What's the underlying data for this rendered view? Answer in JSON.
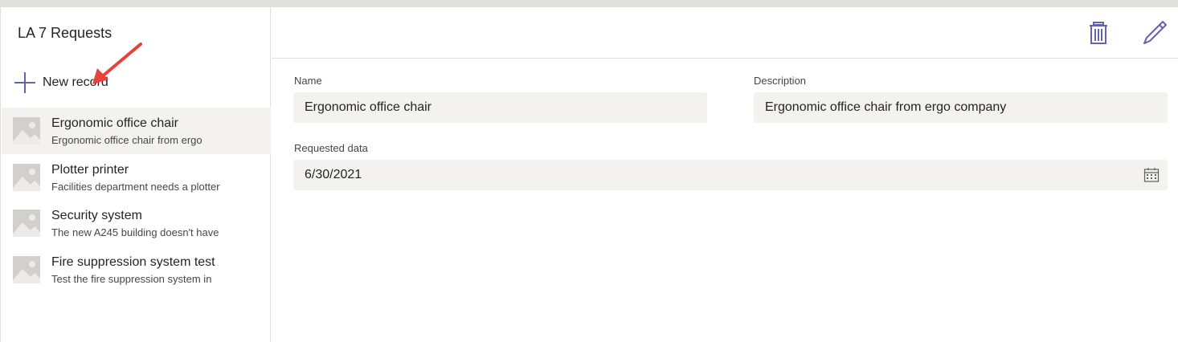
{
  "sidebar": {
    "title": "LA 7 Requests",
    "new_record_label": "New record",
    "items": [
      {
        "title": "Ergonomic office chair",
        "subtitle": "Ergonomic office chair from ergo",
        "selected": true
      },
      {
        "title": "Plotter printer",
        "subtitle": "Facilities department needs a plotter",
        "selected": false
      },
      {
        "title": "Security system",
        "subtitle": "The new A245 building doesn't have",
        "selected": false
      },
      {
        "title": "Fire suppression system test",
        "subtitle": "Test the fire suppression system in",
        "selected": false
      }
    ]
  },
  "toolbar": {
    "delete_icon": "trash-icon",
    "edit_icon": "pencil-icon"
  },
  "form": {
    "name_label": "Name",
    "name_value": "Ergonomic office chair",
    "description_label": "Description",
    "description_value": "Ergonomic office chair from ergo company",
    "date_label": "Requested data",
    "date_value": "6/30/2021"
  },
  "colors": {
    "accent": "#6264a7",
    "arrow": "#e8403a",
    "field_bg": "#f3f2f1",
    "selected_bg": "#f3f2f1"
  }
}
